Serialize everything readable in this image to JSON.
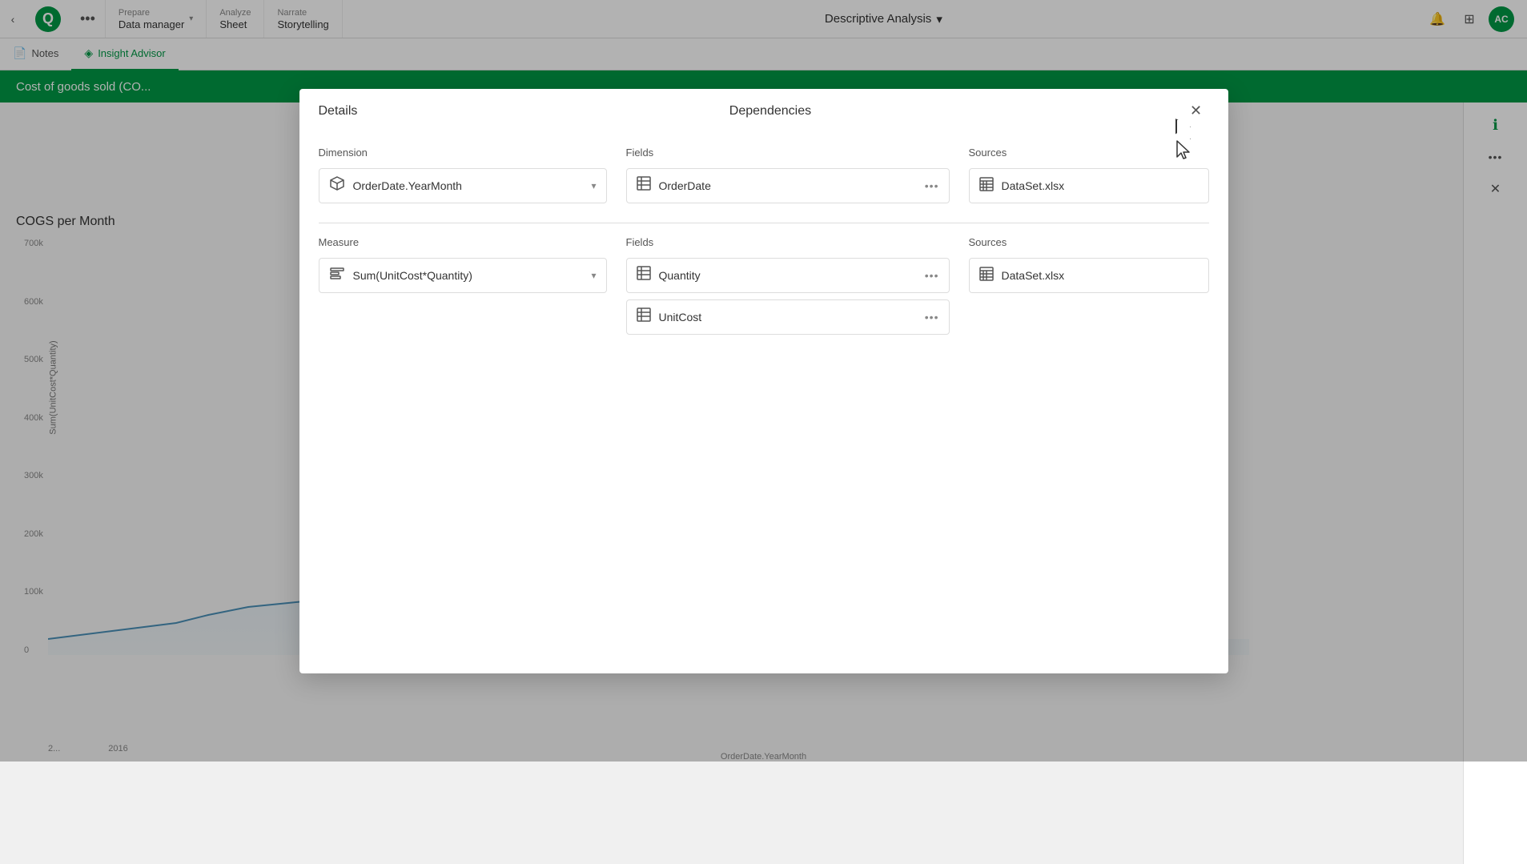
{
  "topNav": {
    "back_icon": "‹",
    "logo_letter": "Q",
    "dots_label": "•••",
    "sections": [
      {
        "title": "Prepare",
        "name": "Data manager",
        "hasChevron": true
      },
      {
        "title": "Analyze",
        "name": "Sheet",
        "hasChevron": false
      },
      {
        "title": "Narrate",
        "name": "Storytelling",
        "hasChevron": false
      }
    ],
    "center_title": "Descriptive Analysis",
    "center_chevron": "▾",
    "right_icons": [
      "🔔",
      "⊞"
    ],
    "avatar_label": "AC"
  },
  "tabBar": {
    "tabs": [
      {
        "id": "notes",
        "label": "Notes",
        "icon": "📄",
        "active": false
      },
      {
        "id": "insight-advisor",
        "label": "Insight Advisor",
        "icon": "◈",
        "active": true
      }
    ]
  },
  "greenHeader": {
    "title": "Cost of goods sold (CO..."
  },
  "chartArea": {
    "title": "COGS per Month",
    "yaxis_label": "Sum(UnitCost*Quantity)",
    "xaxis_label": "OrderDate.YearMonth",
    "yTicks": [
      "700k",
      "600k",
      "500k",
      "400k",
      "300k",
      "200k",
      "100k",
      "0"
    ],
    "xLabels": [
      "2...",
      "2016"
    ]
  },
  "rightPanel": {
    "info_icon": "ℹ",
    "more_icon": "•••",
    "close_icon": "✕"
  },
  "modal": {
    "details_label": "Details",
    "dependencies_label": "Dependencies",
    "close_icon": "✕",
    "sections": {
      "dimension": {
        "label": "Dimension",
        "fields_label": "Fields",
        "sources_label": "Sources",
        "item": {
          "icon": "⬡",
          "label": "OrderDate.YearMonth",
          "hasChevron": true
        },
        "fields": [
          {
            "label": "OrderDate",
            "hasMore": true
          }
        ],
        "sources": [
          {
            "label": "DataSet.xlsx"
          }
        ]
      },
      "measure": {
        "label": "Measure",
        "fields_label": "Fields",
        "sources_label": "Sources",
        "item": {
          "icon": "∑",
          "label": "Sum(UnitCost*Quantity)",
          "hasChevron": true
        },
        "fields": [
          {
            "label": "Quantity",
            "hasMore": true
          },
          {
            "label": "UnitCost",
            "hasMore": true
          }
        ],
        "sources": [
          {
            "label": "DataSet.xlsx"
          }
        ]
      }
    }
  }
}
